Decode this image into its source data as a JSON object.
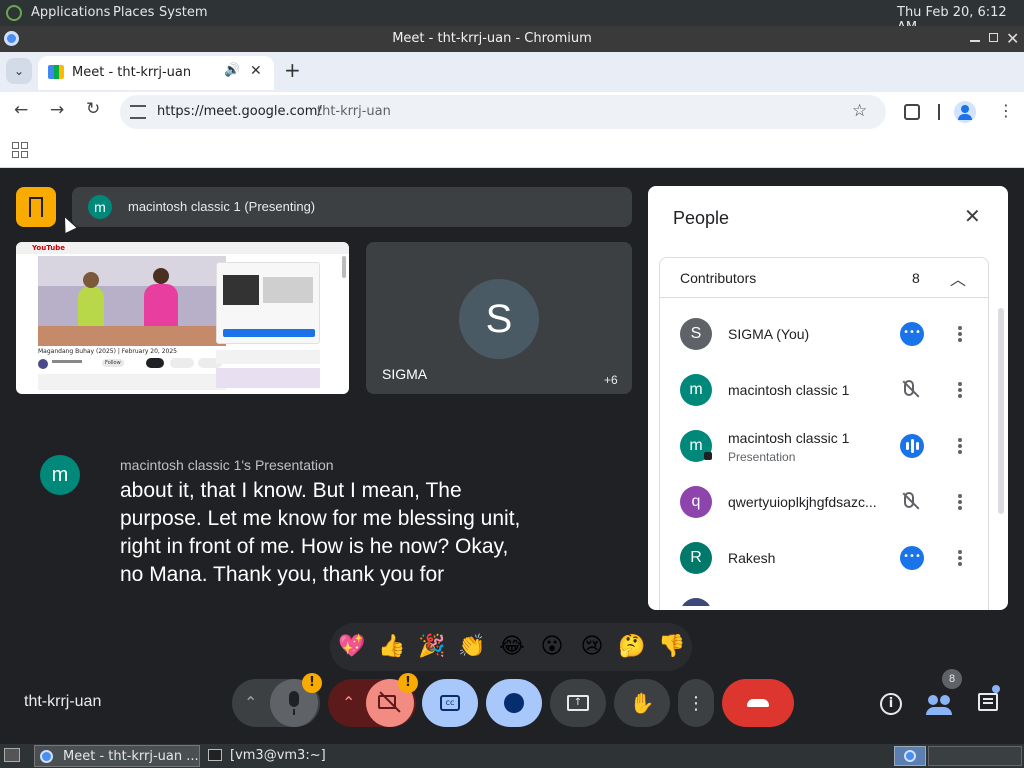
{
  "os_panel": {
    "menus": [
      "Applications",
      "Places",
      "System"
    ],
    "clock": "Thu Feb 20,  6:12 AM"
  },
  "window": {
    "title": "Meet - tht-krrj-uan - Chromium"
  },
  "browser": {
    "tab_title": "Meet - tht-krrj-uan",
    "url_host": "https://meet.google.com/",
    "url_path": "tht-krrj-uan"
  },
  "meet": {
    "presenting_avatar": "m",
    "presenting_label": "macintosh classic 1 (Presenting)",
    "self_tile": {
      "initial": "S",
      "name": "SIGMA",
      "overflow": "+6"
    },
    "caption": {
      "avatar": "m",
      "speaker": "macintosh classic 1's Presentation",
      "lines": [
        "about it, that I know. But I mean, The",
        "purpose. Let me know for me blessing unit,",
        "right in front of me. How is he now? Okay,",
        "no Mana. Thank you, thank you for"
      ]
    },
    "reactions": [
      "💖",
      "👍",
      "🎉",
      "👏",
      "😂",
      "😮",
      "😢",
      "🤔",
      "👎"
    ],
    "meeting_code": "tht-krrj-uan",
    "people_badge": "8",
    "warning_mark": "!",
    "thumb": {
      "logo": "YouTube",
      "video_title": "Magandang Buhay (2025) | February 20, 2025",
      "button": "Follow"
    }
  },
  "people_panel": {
    "title": "People",
    "section": "Contributors",
    "count": "8",
    "participants": [
      {
        "initial": "S",
        "name": "SIGMA (You)",
        "sub": "",
        "color": "#5f6368",
        "status": "more"
      },
      {
        "initial": "m",
        "name": "macintosh classic 1",
        "sub": "",
        "color": "#00897b",
        "status": "muted"
      },
      {
        "initial": "m",
        "name": "macintosh classic 1",
        "sub": "Presentation",
        "color": "#00897b",
        "status": "speaking"
      },
      {
        "initial": "q",
        "name": "qwertyuioplkjhgfdsazc...",
        "sub": "",
        "color": "#8e44ad",
        "status": "muted"
      },
      {
        "initial": "R",
        "name": "Rakesh",
        "sub": "",
        "color": "#00796b",
        "status": "more"
      }
    ]
  },
  "taskbar": {
    "items": [
      "Meet - tht-krrj-uan ...",
      "[vm3@vm3:~]"
    ]
  }
}
